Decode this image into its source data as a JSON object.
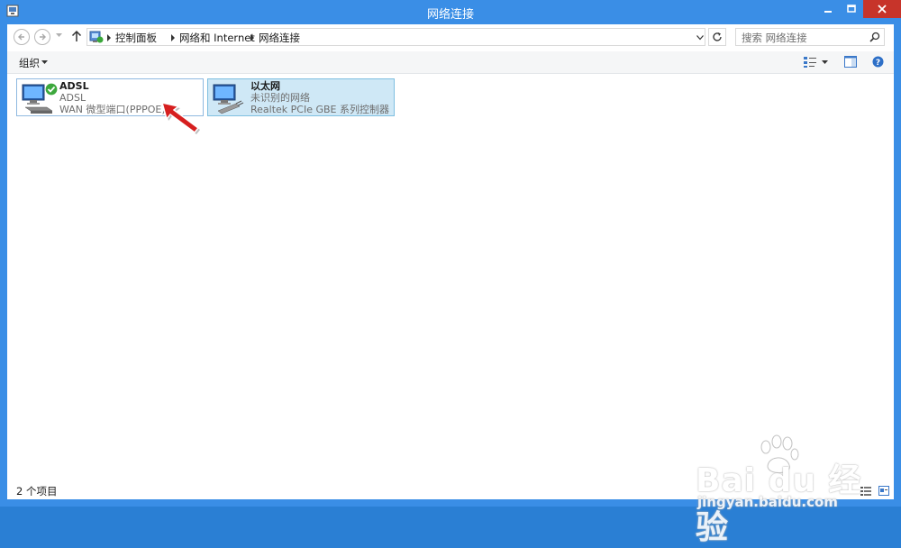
{
  "window": {
    "title": "网络连接"
  },
  "address": {
    "crumbs": [
      "控制面板",
      "网络和 Internet",
      "网络连接"
    ]
  },
  "search": {
    "placeholder": "搜索 网络连接"
  },
  "toolbar": {
    "organize_label": "组织"
  },
  "connections": [
    {
      "name": "ADSL",
      "status": "ADSL",
      "device": "WAN 微型端口(PPPOE)",
      "icon": "adsl-connected-icon"
    },
    {
      "name": "以太网",
      "status": "未识别的网络",
      "device": "Realtek PCIe GBE 系列控制器",
      "icon": "ethernet-icon"
    }
  ],
  "status_bar": {
    "item_count": "2 个项目"
  },
  "watermark": {
    "brand": "Bai du 经验",
    "sub": "jingyan.baidu.com"
  },
  "colors": {
    "titlebar": "#3a8ee6",
    "close": "#c7342a",
    "selected_tile": "#cfe8f6",
    "arrow": "#d61f1f"
  }
}
